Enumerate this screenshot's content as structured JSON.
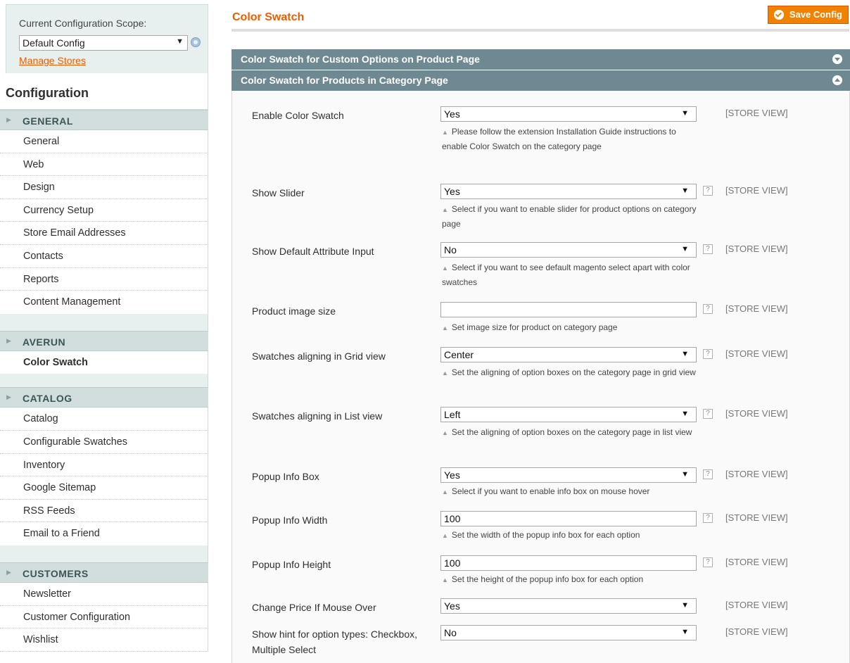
{
  "scope": {
    "label": "Current Configuration Scope:",
    "selected": "Default Config",
    "manage_link": "Manage Stores"
  },
  "sidebar": {
    "title": "Configuration",
    "groups": [
      {
        "label": "GENERAL",
        "items": [
          "General",
          "Web",
          "Design",
          "Currency Setup",
          "Store Email Addresses",
          "Contacts",
          "Reports",
          "Content Management"
        ]
      },
      {
        "label": "AVERUN",
        "items": [
          "Color Swatch"
        ]
      },
      {
        "label": "CATALOG",
        "items": [
          "Catalog",
          "Configurable Swatches",
          "Inventory",
          "Google Sitemap",
          "RSS Feeds",
          "Email to a Friend"
        ]
      },
      {
        "label": "CUSTOMERS",
        "items": [
          "Newsletter",
          "Customer Configuration",
          "Wishlist"
        ]
      }
    ]
  },
  "main": {
    "title": "Color Swatch",
    "save_label": "Save Config",
    "sections": [
      {
        "label": "Color Swatch for Custom Options on Product Page",
        "state": "collapsed"
      },
      {
        "label": "Color Swatch for Products in Category Page",
        "state": "expanded"
      }
    ],
    "fields": [
      {
        "label": "Enable Color Swatch",
        "value": "Yes",
        "scope": "[STORE VIEW]",
        "comment": "Please follow the extension Installation Guide instructions to enable Color Swatch on the category page"
      },
      {
        "label": "Show Slider",
        "value": "Yes",
        "scope": "[STORE VIEW]",
        "hint": "?",
        "comment": "Select if you want to enable slider for product options on category page"
      },
      {
        "label": "Show Default Attribute Input",
        "value": "No",
        "scope": "[STORE VIEW]",
        "hint": "?",
        "comment": "Select if you want to see default magento select apart with color swatches"
      },
      {
        "label": "Product image size",
        "value": "",
        "scope": "[STORE VIEW]",
        "hint": "?",
        "comment": "Set image size for product on category page"
      },
      {
        "label": "Swatches aligning in Grid view",
        "value": "Center",
        "scope": "[STORE VIEW]",
        "hint": "?",
        "comment": "Set the aligning of option boxes on the category page in grid view"
      },
      {
        "label": "Swatches aligning in List view",
        "value": "Left",
        "scope": "[STORE VIEW]",
        "hint": "?",
        "comment": "Set the aligning of option boxes on the category page in list view"
      },
      {
        "label": "Popup Info Box",
        "value": "Yes",
        "scope": "[STORE VIEW]",
        "hint": "?",
        "comment": "Select if you want to enable info box on mouse hover"
      },
      {
        "label": "Popup Info Width",
        "value": "100",
        "scope": "[STORE VIEW]",
        "hint": "?",
        "comment": "Set the width of the popup info box for each option"
      },
      {
        "label": "Popup Info Height",
        "value": "100",
        "scope": "[STORE VIEW]",
        "hint": "?",
        "comment": "Set the height of the popup info box for each option"
      },
      {
        "label": "Change Price If Mouse Over",
        "value": "Yes",
        "scope": "[STORE VIEW]"
      },
      {
        "label": "Show hint for option types: Checkbox, Multiple Select",
        "value": "No",
        "scope": "[STORE VIEW]"
      }
    ]
  },
  "colors": {
    "accent": "#eb5e00",
    "button": "#f18200",
    "section_header": "#6f8992",
    "nav_group": "#d1dedd"
  }
}
